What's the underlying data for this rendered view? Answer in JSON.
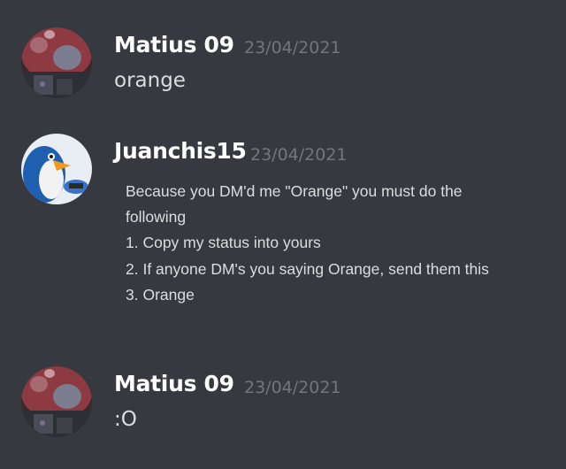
{
  "messages": [
    {
      "author": "Matius 09",
      "timestamp": "23/04/2021",
      "content": "orange",
      "avatar": "mushroom-avatar-icon"
    },
    {
      "author": "Juanchis15",
      "timestamp": "23/04/2021",
      "avatar": "penguin-avatar-icon",
      "image_text": [
        "Because you DM'd me \"Orange\" you must do the",
        "following",
        "1. Copy my status into yours",
        "2. If anyone DM's you saying Orange, send them this",
        "3. Orange"
      ]
    },
    {
      "author": "Matius 09",
      "timestamp": "23/04/2021",
      "content": ":O",
      "avatar": "mushroom-avatar-icon"
    }
  ],
  "colors": {
    "background": "#36393f",
    "username": "#ffffff",
    "timestamp": "#72767d",
    "text": "#dcddde"
  }
}
